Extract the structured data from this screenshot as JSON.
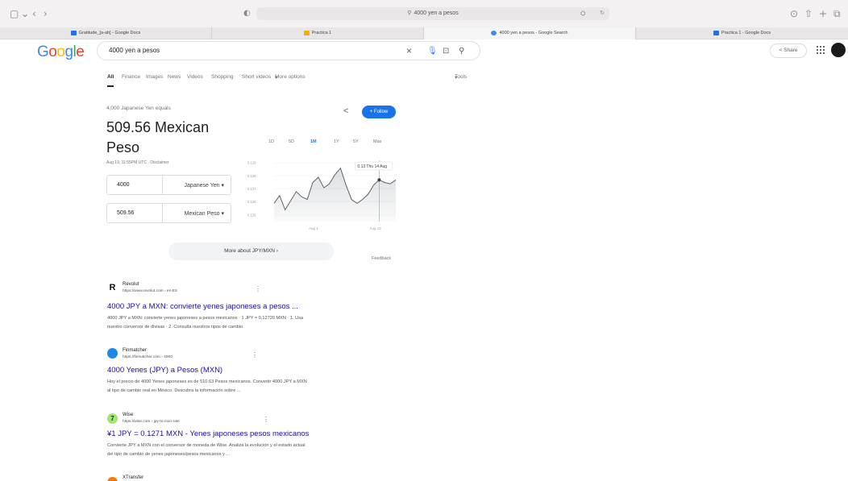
{
  "browser": {
    "address": "4000 yen a pesos",
    "tabs": [
      {
        "label": "Gratitude_[a-ab] - Google Docs",
        "color": "#1a73e8"
      },
      {
        "label": "Practica 1",
        "color": "#f9ab00"
      },
      {
        "label": "4000 yen a pesos - Google Search",
        "color": "#4285f4"
      },
      {
        "label": "Practica 1 - Google Docs",
        "color": "#1a73e8"
      }
    ]
  },
  "google": {
    "logo": {
      "g1": "G",
      "o1": "o",
      "o2": "o",
      "g2": "g",
      "l": "l",
      "e": "e"
    },
    "query": "4000 yen a pesos",
    "share_label": "Share",
    "nav": [
      "All",
      "Finance",
      "Images",
      "News",
      "Videos",
      "Shopping",
      "Short videos",
      "More options",
      "Tools"
    ]
  },
  "converter": {
    "equals_label": "4,000 Japanese Yen equals",
    "result_line1": "509.56 Mexican",
    "result_line2": "Peso",
    "timestamp": "Aug 19, 11:55PM UTC · Disclaimer",
    "follow_label": "+ Follow",
    "from_value": "4000",
    "from_unit": "Japanese Yen",
    "to_value": "509.56",
    "to_unit": "Mexican Peso",
    "ranges": [
      "1D",
      "5D",
      "1M",
      "1Y",
      "5Y",
      "Max"
    ],
    "selected_range": "1M",
    "more_label": "More about JPY/MXN",
    "feedback": "Feedback"
  },
  "chart_data": {
    "type": "area",
    "title": "",
    "yticks": [
      "0.129",
      "0.128",
      "0.127",
      "0.126",
      "0.125"
    ],
    "xticks": [
      "Aug 1",
      "Aug 12"
    ],
    "ylim": [
      0.1245,
      0.1292
    ],
    "values": [
      0.1259,
      0.1265,
      0.1254,
      0.1261,
      0.1268,
      0.1264,
      0.1262,
      0.1275,
      0.1279,
      0.1271,
      0.1274,
      0.1281,
      0.1286,
      0.1273,
      0.1262,
      0.1259,
      0.1262,
      0.1266,
      0.1273,
      0.1277,
      0.1275,
      0.1274,
      0.1277
    ],
    "tooltip": "0.13 Thu 14 Aug"
  },
  "results": [
    {
      "site": "Revolut",
      "url": "https://www.revolut.com › es-ES",
      "icon_text": "R",
      "icon_color": "#ffffff",
      "title": "4000 JPY a MXN: convierte yenes japoneses a pesos ...",
      "snippet1": "4000 JPY a MXN: convierte yenes japoneses a pesos mexicanos · 1 JPY = 0,12720 MXN · 1. Usa",
      "snippet2": "nuestro conversor de divisas · 2. Consulta nuestros tipos de cambio."
    },
    {
      "site": "Finmatcher",
      "url": "https://finmatcher.com › 4000",
      "icon_text": "",
      "icon_color": "#1e88e5",
      "title": "4000 Yenes (JPY) a Pesos (MXN)",
      "snippet1": "Hoy el precio de 4000 Yenes japoneses es de 510.63 Pesos mexicanos. Convertir 4000 JPY a MXN",
      "snippet2": "al tipo de cambio real en México. Descubra la información sobre ..."
    },
    {
      "site": "Wise",
      "url": "https://wise.com › jpy-to-mxn-rate",
      "icon_text": "7",
      "icon_color": "#9fe870",
      "title": "¥1 JPY = 0.1271 MXN - Yenes japoneses pesos mexicanos",
      "snippet1": "Convierte JPY a MXN con el conversor de moneda de Wise. Analiza la evolución y el estado actual",
      "snippet2": "del tipo de cambio de yenes japoneses/pesos mexicanos y ..."
    },
    {
      "site": "XTransfer",
      "icon_color": "#f57c00"
    }
  ]
}
